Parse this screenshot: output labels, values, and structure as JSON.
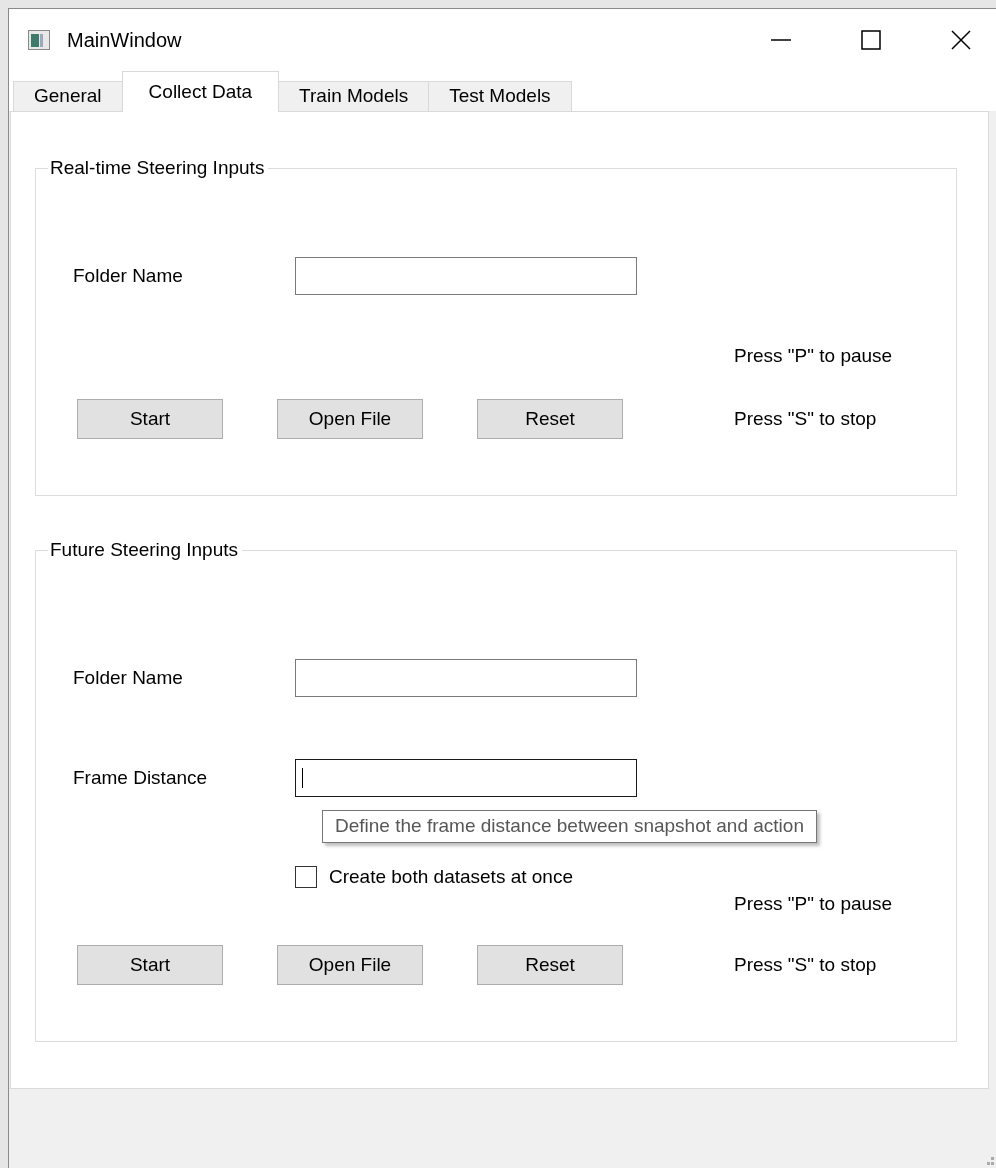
{
  "window": {
    "title": "MainWindow"
  },
  "tabs": [
    {
      "label": "General",
      "selected": false
    },
    {
      "label": "Collect Data",
      "selected": true
    },
    {
      "label": "Train Models",
      "selected": false
    },
    {
      "label": "Test Models",
      "selected": false
    }
  ],
  "groups": [
    {
      "title": "Real-time Steering Inputs",
      "fields": [
        {
          "label": "Folder Name",
          "focused": false
        }
      ],
      "pause_hint": "Press \"P\" to pause",
      "stop_hint": "Press \"S\" to stop",
      "buttons": [
        "Start",
        "Open File",
        "Reset"
      ]
    },
    {
      "title": "Future Steering Inputs",
      "fields": [
        {
          "label": "Folder Name",
          "focused": false
        },
        {
          "label": "Frame Distance",
          "focused": true,
          "tooltip": "Define the frame distance between snapshot and action"
        }
      ],
      "checkbox": {
        "label": "Create both datasets at once",
        "checked": false
      },
      "pause_hint": "Press \"P\" to pause",
      "stop_hint": "Press \"S\" to stop",
      "buttons": [
        "Start",
        "Open File",
        "Reset"
      ]
    }
  ]
}
